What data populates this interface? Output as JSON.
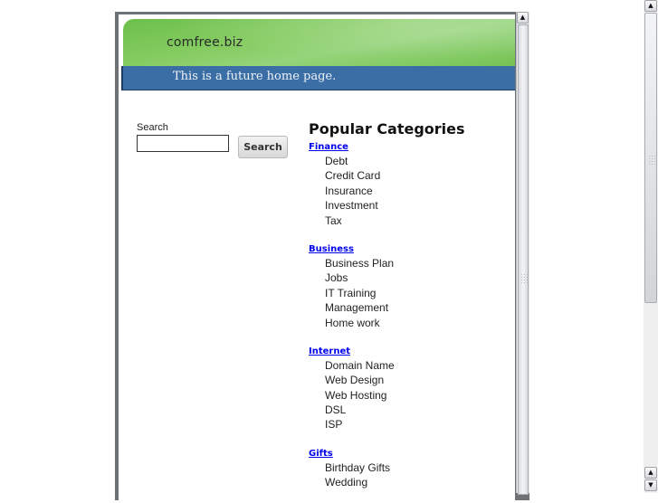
{
  "header": {
    "site_title": "comfree.biz",
    "tagline": "This is a future home page."
  },
  "search": {
    "label": "Search",
    "input_value": "",
    "button_label": "Search"
  },
  "categories": {
    "title": "Popular Categories",
    "groups": [
      {
        "label": "Finance",
        "items": [
          "Debt",
          "Credit Card",
          "Insurance",
          "Investment",
          "Tax"
        ]
      },
      {
        "label": "Business",
        "items": [
          "Business Plan",
          "Jobs",
          "IT Training",
          "Management",
          "Home work"
        ]
      },
      {
        "label": "Internet",
        "items": [
          "Domain Name",
          "Web Design",
          "Web Hosting",
          "DSL",
          "ISP"
        ]
      },
      {
        "label": "Gifts",
        "items": [
          "Birthday Gifts",
          "Wedding"
        ]
      }
    ]
  },
  "icons": {
    "scroll_up": "▲",
    "scroll_down": "▼"
  },
  "colors": {
    "header_green": "#7dc55a",
    "header_blue": "#3a6ea5",
    "link": "#0000ee"
  }
}
